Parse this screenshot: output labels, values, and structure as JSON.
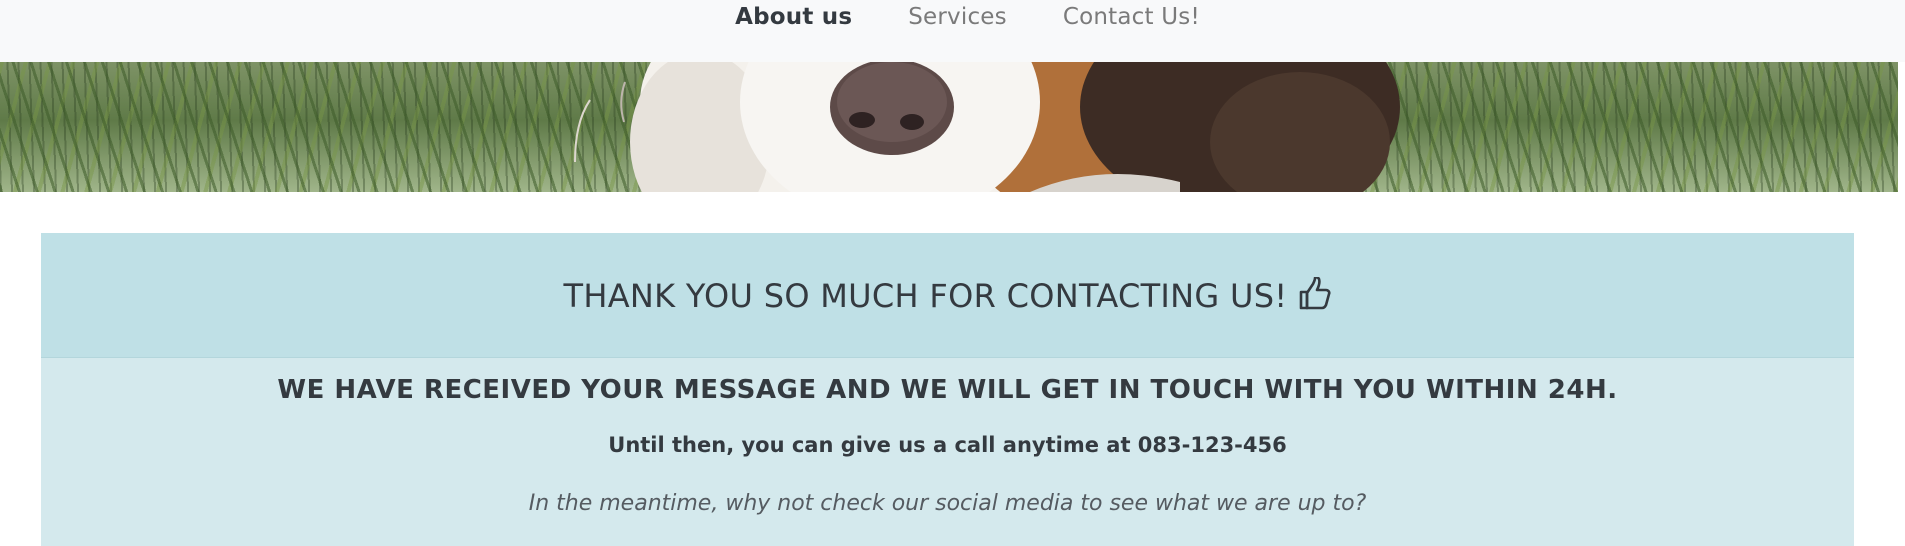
{
  "nav": {
    "items": [
      {
        "label": "About us",
        "active": true
      },
      {
        "label": "Services",
        "active": false
      },
      {
        "label": "Contact Us!",
        "active": false
      }
    ]
  },
  "hero": {
    "image": "dog-in-grass-photo"
  },
  "confirmation": {
    "title": "THANK YOU SO MUCH FOR CONTACTING US!",
    "title_icon": "thumbs-up-icon",
    "received": "WE HAVE RECEIVED YOUR MESSAGE AND WE WILL GET IN TOUCH WITH YOU WITHIN 24H.",
    "call": "Until then, you can give us a call anytime at 083-123-456",
    "social": "In the meantime, why not check our social media to see what we are up to?"
  },
  "colors": {
    "navbar_bg": "#f8f9fa",
    "panel_header_bg": "#bfe0e6",
    "panel_body_bg": "#d4e9ed",
    "text_dark": "#343a40"
  }
}
